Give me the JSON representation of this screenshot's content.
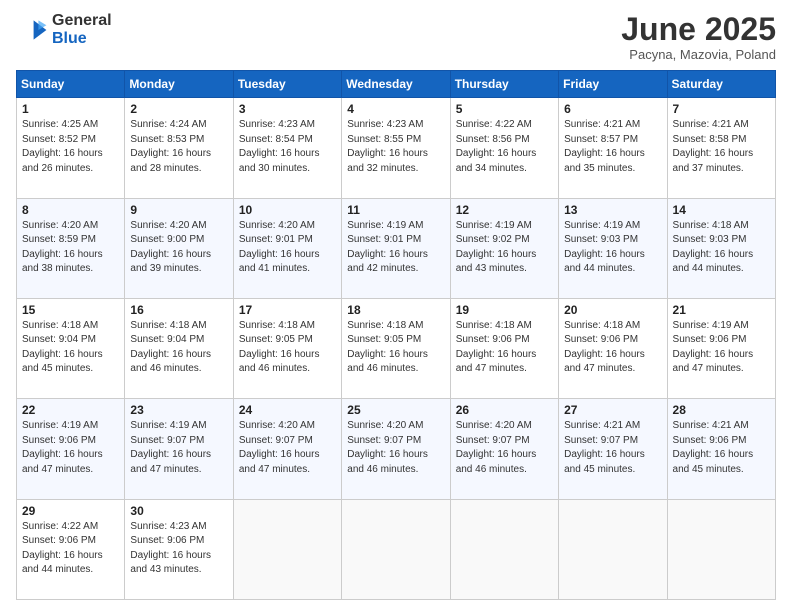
{
  "header": {
    "logo_general": "General",
    "logo_blue": "Blue",
    "month_year": "June 2025",
    "location": "Pacyna, Mazovia, Poland"
  },
  "days_of_week": [
    "Sunday",
    "Monday",
    "Tuesday",
    "Wednesday",
    "Thursday",
    "Friday",
    "Saturday"
  ],
  "weeks": [
    [
      {
        "day": "1",
        "info": "Sunrise: 4:25 AM\nSunset: 8:52 PM\nDaylight: 16 hours\nand 26 minutes."
      },
      {
        "day": "2",
        "info": "Sunrise: 4:24 AM\nSunset: 8:53 PM\nDaylight: 16 hours\nand 28 minutes."
      },
      {
        "day": "3",
        "info": "Sunrise: 4:23 AM\nSunset: 8:54 PM\nDaylight: 16 hours\nand 30 minutes."
      },
      {
        "day": "4",
        "info": "Sunrise: 4:23 AM\nSunset: 8:55 PM\nDaylight: 16 hours\nand 32 minutes."
      },
      {
        "day": "5",
        "info": "Sunrise: 4:22 AM\nSunset: 8:56 PM\nDaylight: 16 hours\nand 34 minutes."
      },
      {
        "day": "6",
        "info": "Sunrise: 4:21 AM\nSunset: 8:57 PM\nDaylight: 16 hours\nand 35 minutes."
      },
      {
        "day": "7",
        "info": "Sunrise: 4:21 AM\nSunset: 8:58 PM\nDaylight: 16 hours\nand 37 minutes."
      }
    ],
    [
      {
        "day": "8",
        "info": "Sunrise: 4:20 AM\nSunset: 8:59 PM\nDaylight: 16 hours\nand 38 minutes."
      },
      {
        "day": "9",
        "info": "Sunrise: 4:20 AM\nSunset: 9:00 PM\nDaylight: 16 hours\nand 39 minutes."
      },
      {
        "day": "10",
        "info": "Sunrise: 4:20 AM\nSunset: 9:01 PM\nDaylight: 16 hours\nand 41 minutes."
      },
      {
        "day": "11",
        "info": "Sunrise: 4:19 AM\nSunset: 9:01 PM\nDaylight: 16 hours\nand 42 minutes."
      },
      {
        "day": "12",
        "info": "Sunrise: 4:19 AM\nSunset: 9:02 PM\nDaylight: 16 hours\nand 43 minutes."
      },
      {
        "day": "13",
        "info": "Sunrise: 4:19 AM\nSunset: 9:03 PM\nDaylight: 16 hours\nand 44 minutes."
      },
      {
        "day": "14",
        "info": "Sunrise: 4:18 AM\nSunset: 9:03 PM\nDaylight: 16 hours\nand 44 minutes."
      }
    ],
    [
      {
        "day": "15",
        "info": "Sunrise: 4:18 AM\nSunset: 9:04 PM\nDaylight: 16 hours\nand 45 minutes."
      },
      {
        "day": "16",
        "info": "Sunrise: 4:18 AM\nSunset: 9:04 PM\nDaylight: 16 hours\nand 46 minutes."
      },
      {
        "day": "17",
        "info": "Sunrise: 4:18 AM\nSunset: 9:05 PM\nDaylight: 16 hours\nand 46 minutes."
      },
      {
        "day": "18",
        "info": "Sunrise: 4:18 AM\nSunset: 9:05 PM\nDaylight: 16 hours\nand 46 minutes."
      },
      {
        "day": "19",
        "info": "Sunrise: 4:18 AM\nSunset: 9:06 PM\nDaylight: 16 hours\nand 47 minutes."
      },
      {
        "day": "20",
        "info": "Sunrise: 4:18 AM\nSunset: 9:06 PM\nDaylight: 16 hours\nand 47 minutes."
      },
      {
        "day": "21",
        "info": "Sunrise: 4:19 AM\nSunset: 9:06 PM\nDaylight: 16 hours\nand 47 minutes."
      }
    ],
    [
      {
        "day": "22",
        "info": "Sunrise: 4:19 AM\nSunset: 9:06 PM\nDaylight: 16 hours\nand 47 minutes."
      },
      {
        "day": "23",
        "info": "Sunrise: 4:19 AM\nSunset: 9:07 PM\nDaylight: 16 hours\nand 47 minutes."
      },
      {
        "day": "24",
        "info": "Sunrise: 4:20 AM\nSunset: 9:07 PM\nDaylight: 16 hours\nand 47 minutes."
      },
      {
        "day": "25",
        "info": "Sunrise: 4:20 AM\nSunset: 9:07 PM\nDaylight: 16 hours\nand 46 minutes."
      },
      {
        "day": "26",
        "info": "Sunrise: 4:20 AM\nSunset: 9:07 PM\nDaylight: 16 hours\nand 46 minutes."
      },
      {
        "day": "27",
        "info": "Sunrise: 4:21 AM\nSunset: 9:07 PM\nDaylight: 16 hours\nand 45 minutes."
      },
      {
        "day": "28",
        "info": "Sunrise: 4:21 AM\nSunset: 9:06 PM\nDaylight: 16 hours\nand 45 minutes."
      }
    ],
    [
      {
        "day": "29",
        "info": "Sunrise: 4:22 AM\nSunset: 9:06 PM\nDaylight: 16 hours\nand 44 minutes."
      },
      {
        "day": "30",
        "info": "Sunrise: 4:23 AM\nSunset: 9:06 PM\nDaylight: 16 hours\nand 43 minutes."
      },
      {
        "day": "",
        "info": ""
      },
      {
        "day": "",
        "info": ""
      },
      {
        "day": "",
        "info": ""
      },
      {
        "day": "",
        "info": ""
      },
      {
        "day": "",
        "info": ""
      }
    ]
  ]
}
